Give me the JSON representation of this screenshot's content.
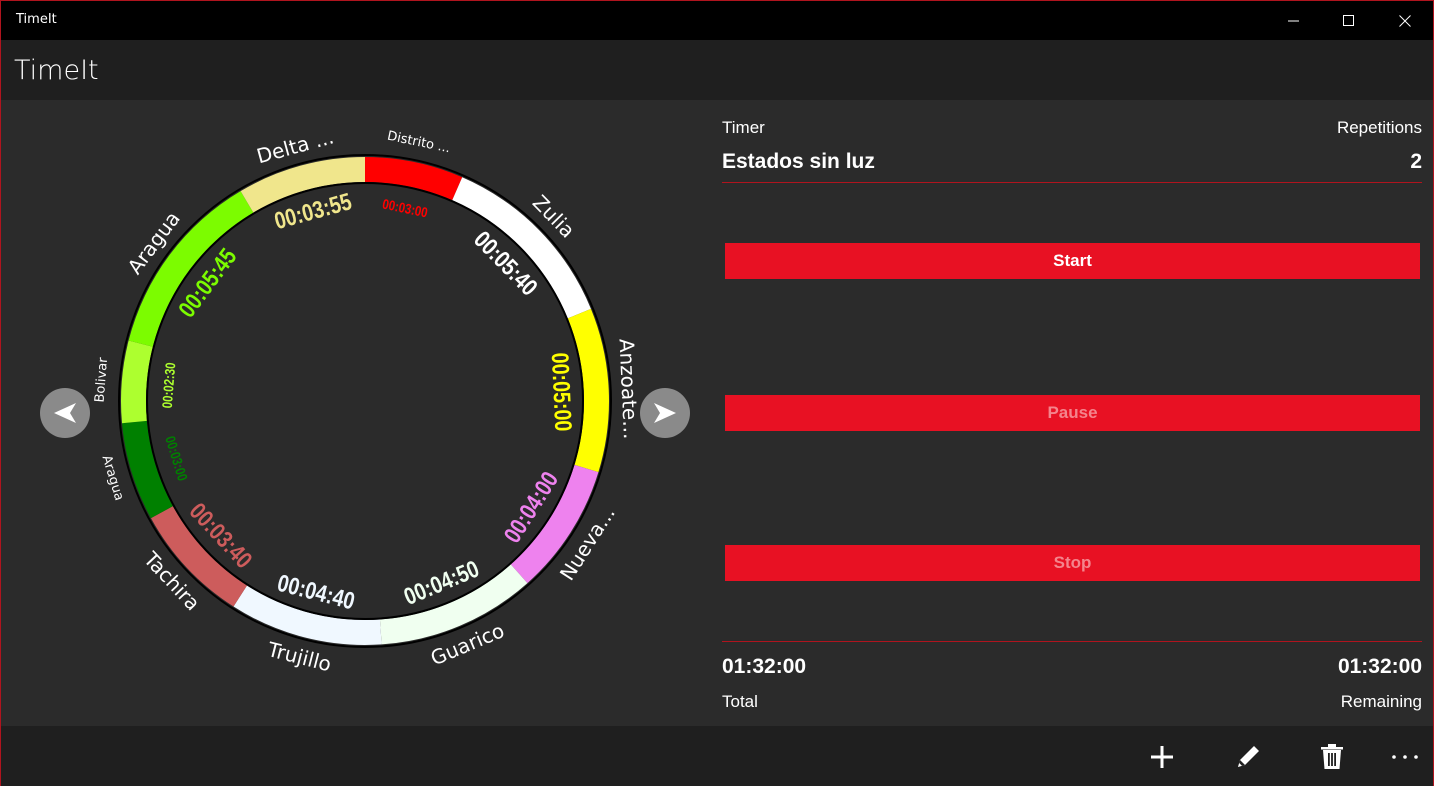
{
  "window": {
    "title": "TimeIt"
  },
  "app": {
    "title": "TimeIt"
  },
  "segments": [
    {
      "name": "Distrito ...",
      "time": "00:03:00",
      "color": "#ff0000"
    },
    {
      "name": "Zulia",
      "time": "00:05:40",
      "color": "#ffffff"
    },
    {
      "name": "Anzoate...",
      "time": "00:05:00",
      "color": "#ffff00"
    },
    {
      "name": "Nueva...",
      "time": "00:04:00",
      "color": "#ee82ee"
    },
    {
      "name": "Guarico",
      "time": "00:04:50",
      "color": "#f0fff0"
    },
    {
      "name": "Trujillo",
      "time": "00:04:40",
      "color": "#f0f8ff"
    },
    {
      "name": "Tachira",
      "time": "00:03:40",
      "color": "#cd5c5c"
    },
    {
      "name": "Aragua",
      "time": "00:03:00",
      "color": "#008000"
    },
    {
      "name": "Bolivar",
      "time": "00:02:30",
      "color": "#adff2f"
    },
    {
      "name": "Aragua",
      "time": "00:05:45",
      "color": "#7cfc00"
    },
    {
      "name": "Delta ...",
      "time": "00:03:55",
      "color": "#f0e68c"
    }
  ],
  "panel": {
    "timer_label": "Timer",
    "repetitions_label": "Repetitions",
    "timer_name": "Estados sin luz",
    "repetitions": "2",
    "start_label": "Start",
    "pause_label": "Pause",
    "stop_label": "Stop",
    "total_value": "01:32:00",
    "remaining_value": "01:32:00",
    "total_label": "Total",
    "remaining_label": "Remaining"
  },
  "commands": {
    "add_icon": "plus-icon",
    "edit_icon": "pencil-icon",
    "delete_icon": "trash-icon",
    "more_icon": "more-icon"
  },
  "colors": {
    "accent": "#e81123",
    "background": "#2b2b2b",
    "bar": "#1f1f1f"
  }
}
